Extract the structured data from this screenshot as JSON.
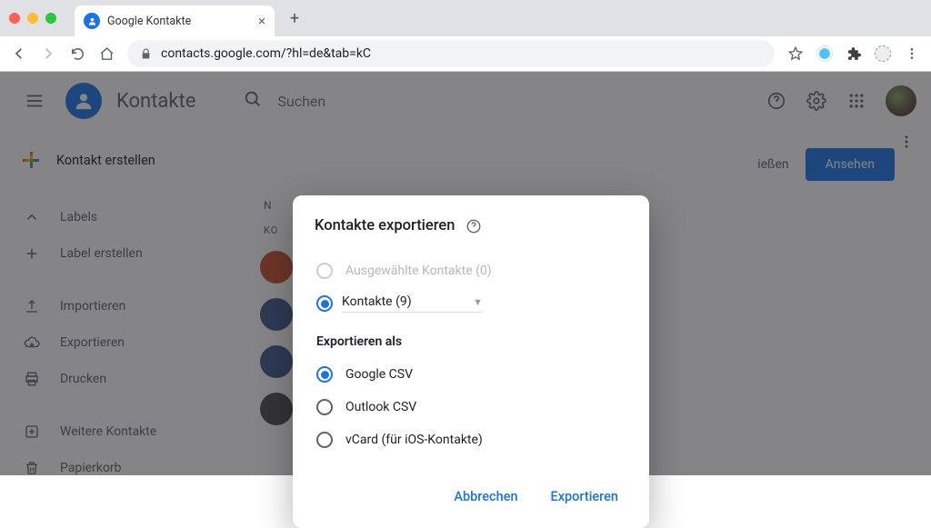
{
  "browser": {
    "tab_title": "Google Kontakte",
    "url": "contacts.google.com/?hl=de&tab=kC"
  },
  "header": {
    "app_title": "Kontakte",
    "search_placeholder": "Suchen"
  },
  "sidebar": {
    "create_label": "Kontakt erstellen",
    "labels_label": "Labels",
    "create_label_label": "Label erstellen",
    "import_label": "Importieren",
    "export_label": "Exportieren",
    "print_label": "Drucken",
    "other_label": "Weitere Kontakte",
    "trash_label": "Papierkorb"
  },
  "main": {
    "alert_text": "ießen",
    "alert_button": "Ansehen",
    "list_header": "N",
    "section_letter": "KO"
  },
  "dialog": {
    "title": "Kontakte exportieren",
    "option_selected_disabled": "Ausgewählte Kontakte (0)",
    "option_all": "Kontakte (9)",
    "format_heading": "Exportieren als",
    "format_google": "Google CSV",
    "format_outlook": "Outlook CSV",
    "format_vcard": "vCard (für iOS-Kontakte)",
    "cancel_label": "Abbrechen",
    "export_label": "Exportieren"
  }
}
